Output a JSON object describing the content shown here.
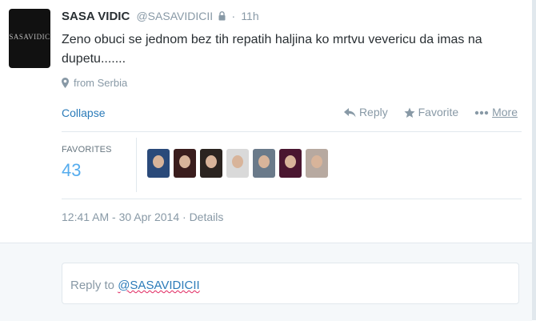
{
  "tweet": {
    "avatar_text": "SASAVIDIC",
    "fullname": "SASA VIDIC",
    "username": "@SASAVIDICII",
    "separator": "·",
    "time": "11h",
    "text": "Zeno obuci se jednom bez tih repatih haljina ko mrtvu vevericu da imas na dupetu.......",
    "location": "from Serbia",
    "collapse_label": "Collapse",
    "actions": {
      "reply": "Reply",
      "favorite": "Favorite",
      "more": "More"
    },
    "stats": {
      "favorites_label": "FAVORITES",
      "favorites_count": "43",
      "favoriter_colors": [
        "#2a4a7a",
        "#3a1d1d",
        "#2b2420",
        "#d9d9d9",
        "#6a7a8a",
        "#4a1630",
        "#b7a9a0"
      ]
    },
    "timestamp": "12:41 AM - 30 Apr 2014",
    "details_label": "Details",
    "colors": {
      "link": "#2b7bb9",
      "count": "#55acee",
      "muted": "#8899a6"
    }
  },
  "reply": {
    "prefix": "Reply to ",
    "mention": "@SASAVIDICII"
  }
}
